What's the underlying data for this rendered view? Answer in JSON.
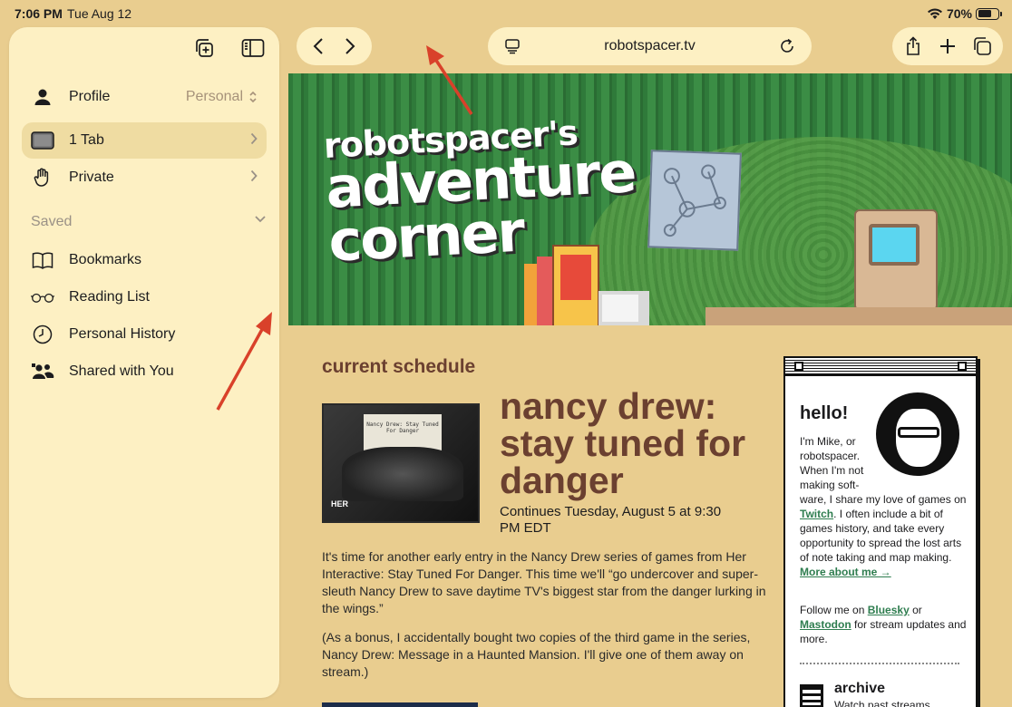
{
  "status_bar": {
    "time": "7:06 PM",
    "date": "Tue Aug 12",
    "battery_percent": "70%",
    "battery_level": 0.7
  },
  "sidebar": {
    "profile": {
      "label": "Profile",
      "value": "Personal"
    },
    "tabs": {
      "label": "1 Tab"
    },
    "private": {
      "label": "Private"
    },
    "saved_header": "Saved",
    "saved_items": [
      {
        "label": "Bookmarks",
        "icon": "book-icon"
      },
      {
        "label": "Reading List",
        "icon": "glasses-icon"
      },
      {
        "label": "Personal History",
        "icon": "clock-icon"
      },
      {
        "label": "Shared with You",
        "icon": "people-icon"
      }
    ]
  },
  "toolbar": {
    "url": "robotspacer.tv"
  },
  "page": {
    "banner_line1": "robotspacer's",
    "banner_line2": "adventure",
    "banner_line3": "corner",
    "schedule_heading": "current schedule",
    "thumb_paper": "Nancy Drew: Stay Tuned For Danger",
    "thumb_logo": "HER",
    "game_title": "nancy drew: stay tuned for danger",
    "continues": "Continues Tuesday, August 5 at 9:30 PM EDT",
    "para1": "It's time for another early entry in the Nancy Drew series of games from Her Interactive: Stay Tuned For Danger. This time we'll “go undercover and super-sleuth Nancy Drew to save daytime TV's biggest star from the danger lurking in the wings.”",
    "para2": "(As a bonus, I accidentally bought two copies of the third game in the series, Nancy Drew: Message in a Haunted Mansion. I'll give one of them away on stream.)"
  },
  "card": {
    "hello": "hello!",
    "intro_a": "I'm Mike, or robotspacer. When I'm not making soft-",
    "intro_b": "ware, I share my love of games on",
    "twitch": "Twitch",
    "intro_c": ". I often include a bit of games history, and take every opportunity to spread the lost arts of note taking and map making.",
    "more": "More about me →",
    "follow_a": "Follow me on",
    "bluesky": "Bluesky",
    "follow_b": "or",
    "mastodon": "Mastodon",
    "follow_c": "for stream updates and more.",
    "archive_title": "archive",
    "archive_sub": "Watch past streams"
  },
  "annotation_color": "#d9412a"
}
